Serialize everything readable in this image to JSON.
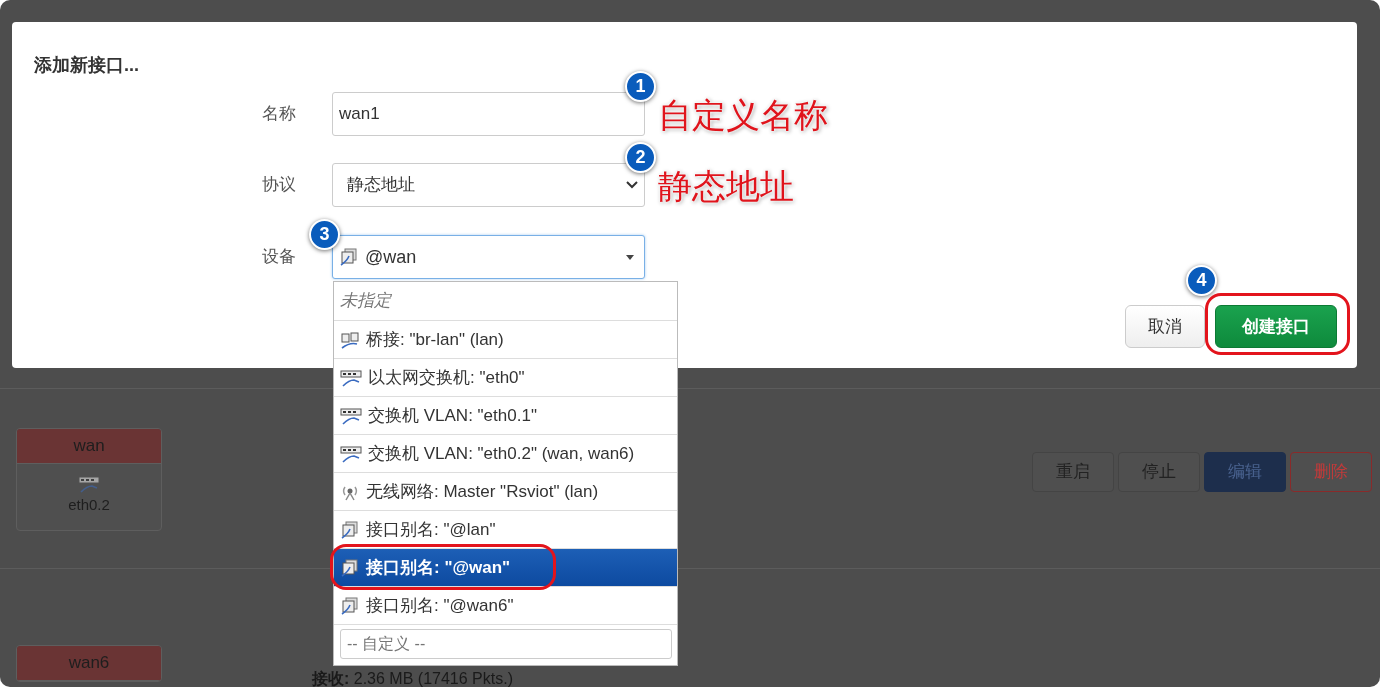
{
  "dialog": {
    "title": "添加新接口...",
    "fields": [
      {
        "label": "名称",
        "kind": "text",
        "value": "wan1"
      },
      {
        "label": "协议",
        "kind": "select",
        "value": "静态地址"
      },
      {
        "label": "设备",
        "kind": "combo",
        "value": "@wan"
      }
    ],
    "buttons": [
      {
        "label": "取消",
        "kind": "cancel"
      },
      {
        "label": "创建接口",
        "kind": "primary"
      }
    ]
  },
  "device_dropdown": {
    "options": [
      {
        "label": "未指定",
        "kind": "none",
        "selected": false
      },
      {
        "label": "桥接: \"br-lan\" (lan)",
        "kind": "bridge",
        "selected": false
      },
      {
        "label": "以太网交换机: \"eth0\"",
        "kind": "switch",
        "selected": false
      },
      {
        "label": "交换机 VLAN: \"eth0.1\"",
        "kind": "switch",
        "selected": false
      },
      {
        "label": "交换机 VLAN: \"eth0.2\" (wan, wan6)",
        "kind": "switch",
        "selected": false
      },
      {
        "label": "无线网络: Master \"Rsviot\" (lan)",
        "kind": "wifi",
        "selected": false
      },
      {
        "label": "接口别名: \"@lan\"",
        "kind": "alias",
        "selected": false
      },
      {
        "label": "接口别名: \"@wan\"",
        "kind": "alias",
        "selected": true
      },
      {
        "label": "接口别名: \"@wan6\"",
        "kind": "alias",
        "selected": false
      }
    ],
    "custom_placeholder": "-- 自定义 --"
  },
  "annotations": [
    {
      "number": "1",
      "note": "自定义名称"
    },
    {
      "number": "2",
      "note": "静态地址"
    },
    {
      "number": "3"
    },
    {
      "number": "4"
    }
  ],
  "background": {
    "interfaces": [
      {
        "name": "wan",
        "device": "eth0.2",
        "buttons": [
          {
            "label": "重启",
            "kind": "plain"
          },
          {
            "label": "停止",
            "kind": "plain"
          },
          {
            "label": "编辑",
            "kind": "edit"
          },
          {
            "label": "删除",
            "kind": "delete"
          }
        ]
      },
      {
        "name": "wan6"
      }
    ],
    "rx_line": "**接收:** 2.36 MB (17416 Pkts.)"
  }
}
